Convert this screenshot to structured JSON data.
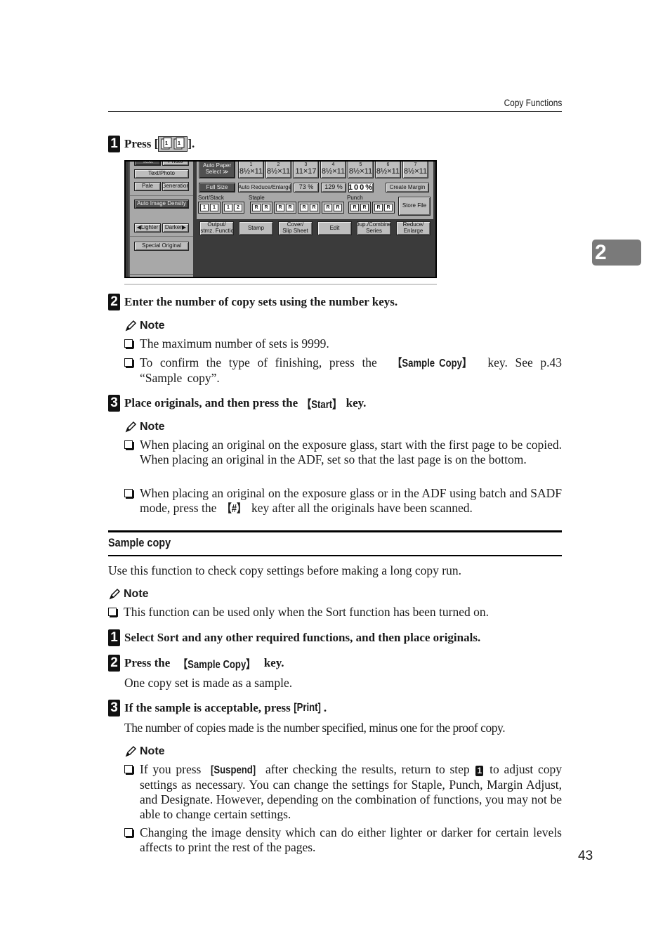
{
  "header": {
    "running_head": "Copy Functions",
    "chapter_tab": "2"
  },
  "step1_top": {
    "number": "1",
    "text_before": "Press [",
    "icon": "sort-icon",
    "text_after": "]."
  },
  "copier_panel": {
    "left_column": {
      "top_buttons": [
        "Text",
        "Photo"
      ],
      "text_photo": "Text/Photo",
      "pale": "Pale",
      "generation": "Generation",
      "auto_image_density": "Auto Image Density",
      "lighter": "Lighter",
      "darker": "Darker",
      "special_original": "Special Original"
    },
    "paper": {
      "auto_paper_select_line1": "Auto Paper",
      "auto_paper_select_line2": "Select ≫",
      "trays": [
        {
          "tray": "1",
          "size": "8½×11"
        },
        {
          "tray": "2",
          "size": "8½×11"
        },
        {
          "tray": "3",
          "size": "11×17"
        },
        {
          "tray": "4",
          "size": "8½×11"
        },
        {
          "tray": "5",
          "size": "8½×11"
        },
        {
          "tray": "6",
          "size": "8½×11"
        },
        {
          "tray": "7",
          "size": "8½×11"
        }
      ]
    },
    "ratio": {
      "full_size": "Full Size",
      "auto_reduce_enlarge": "Auto Reduce/Enlarge",
      "preset1": "73 %",
      "preset2": "129 %",
      "current": "100%",
      "create_margin": "Create Margin"
    },
    "finishing": {
      "sort_stack_label": "Sort/Stack",
      "staple_label": "Staple",
      "punch_label": "Punch",
      "store_file": "Store File",
      "staple_glyph": "R"
    },
    "functions": [
      {
        "line1": "Output/",
        "line2": "Cstmz. Function"
      },
      {
        "line1": "Stamp",
        "line2": ""
      },
      {
        "line1": "Cover/",
        "line2": "Slip Sheet"
      },
      {
        "line1": "Edit",
        "line2": ""
      },
      {
        "line1": "Dup./Combine/",
        "line2": "Series"
      },
      {
        "line1": "Reduce/",
        "line2": "Enlarge"
      }
    ]
  },
  "step2_top": {
    "number": "2",
    "text": "Enter the number of copy sets using the number keys.",
    "note_label": "Note",
    "notes": [
      {
        "text": "The maximum number of sets is 9999."
      },
      {
        "before": "To confirm the type of finishing, press the ",
        "key": "【Sample Copy】",
        "after": " key. See p.43 “Sample copy”."
      }
    ]
  },
  "step3_top": {
    "number": "3",
    "text_before": "Place originals, and then press the ",
    "key": "【Start】",
    "text_after": " key.",
    "note_label": "Note",
    "notes": [
      {
        "text": "When placing an original on the exposure glass, start with the first page to be copied. When placing an original in the ADF, set so that the last page is on the bottom."
      },
      {
        "before": "When placing an original on the exposure glass or in the ADF using batch and SADF mode, press the ",
        "key": "【#】",
        "after": " key after all the originals have been scanned."
      }
    ]
  },
  "sample_copy": {
    "title": "Sample copy",
    "intro": "Use this function to check copy settings before making a long copy run.",
    "note_label": "Note",
    "note": "This function can be used only when the Sort function has been turned on.",
    "step1": {
      "number": "1",
      "text": "Select Sort and any other required functions, and then place originals."
    },
    "step2": {
      "number": "2",
      "text_before": "Press the ",
      "key": "【Sample Copy】",
      "text_after": " key.",
      "body": "One copy set is made as a sample."
    },
    "step3": {
      "number": "3",
      "text_before": "If the sample is acceptable, press ",
      "key": "[Print]",
      "text_after": ".",
      "body": "The number of copies made is the number specified, minus one for the proof copy."
    },
    "final_note_label": "Note",
    "final_notes": [
      {
        "before": "If you press ",
        "key": "[Suspend]",
        "middle": " after checking the results, return to step ",
        "step_ref": "1",
        "after": " to adjust copy settings as necessary. You can change the settings for Staple, Punch, Margin Adjust, and Designate. However, depending on the combination of functions, you may not be able to change certain settings."
      },
      {
        "text": "Changing the image density which can do either lighter or darker for certain levels affects to print the rest of the pages."
      }
    ]
  },
  "footer": {
    "page_number": "43"
  }
}
